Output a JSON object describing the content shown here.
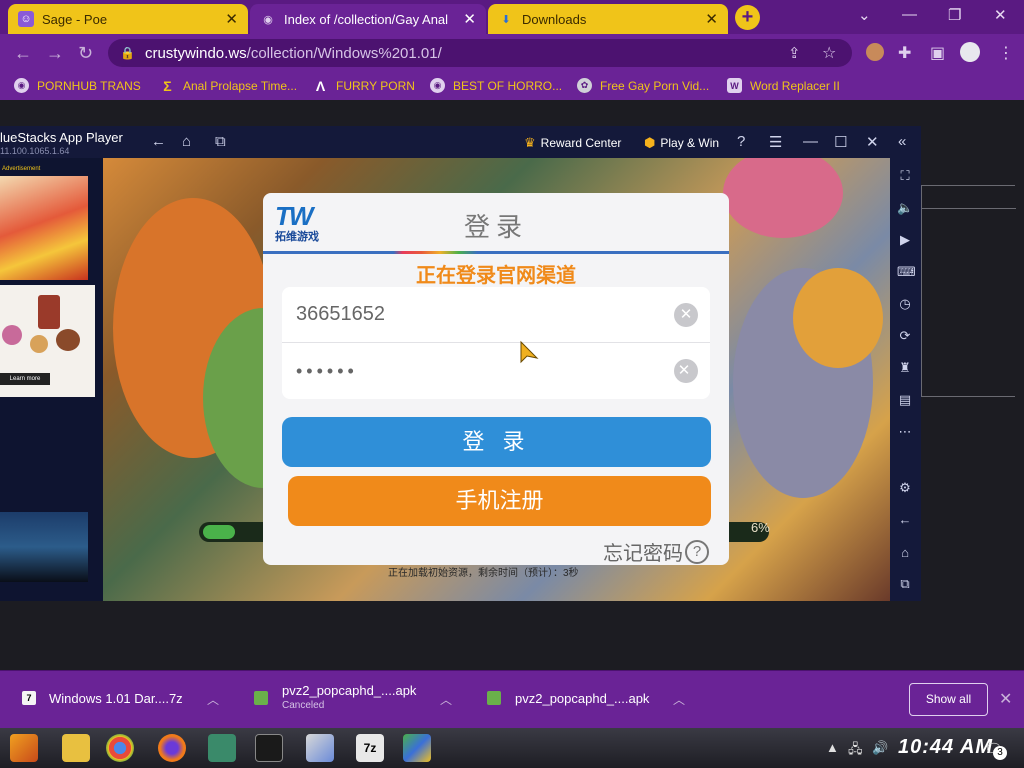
{
  "browser": {
    "tabs": [
      {
        "label": "Sage - Poe",
        "state": "inactive",
        "icon": "poe-icon"
      },
      {
        "label": "Index of /collection/Gay Anal",
        "state": "active",
        "icon": "globe-icon"
      },
      {
        "label": "Downloads",
        "state": "inactive",
        "icon": "download-icon"
      }
    ],
    "new_tab": "+",
    "window_controls": {
      "dropdown": "⌄",
      "minimize": "—",
      "restore": "❐",
      "close": "✕"
    },
    "url_host": "crustywindo.ws",
    "url_path": "/collection/Windows%201.01/",
    "bookmarks": [
      {
        "label": "PORNHUB TRANS"
      },
      {
        "label": "Anal Prolapse Time..."
      },
      {
        "label": "FURRY PORN"
      },
      {
        "label": "BEST OF HORRO..."
      },
      {
        "label": "Free Gay Porn Vid..."
      },
      {
        "label": "Word Replacer II"
      }
    ]
  },
  "bluestacks": {
    "app_name": "lueStacks App Player",
    "version": "11.100.1065.1.64",
    "reward_center": "Reward Center",
    "play_win": "Play & Win",
    "ad_label": "Advertisement",
    "ad_learn": "Learn more"
  },
  "game": {
    "progress_pct": 6,
    "progress_label": "6%",
    "loading_text": "正在加载初始资源，剩余时间（预计）：3秒"
  },
  "login": {
    "logo_text": "TW",
    "logo_sub": "拓维游戏",
    "title": "登录",
    "subtitle": "正在登录官网渠道",
    "username": "36651652",
    "password_mask": "••••••",
    "clear_glyph": "✕",
    "login_button": "登 录",
    "register_button": "手机注册",
    "forgot": "忘记密码",
    "forgot_q": "?"
  },
  "downloads": {
    "items": [
      {
        "name": "Windows 1.01 Dar....7z",
        "status": ""
      },
      {
        "name": "pvz2_popcaphd_....apk",
        "status": "Canceled"
      },
      {
        "name": "pvz2_popcaphd_....apk",
        "status": ""
      }
    ],
    "show_all": "Show all",
    "close": "✕"
  },
  "taskbar": {
    "clock": "10:44 AM",
    "notification_count": "3"
  },
  "colors": {
    "tab_yellow": "#f0c419",
    "chrome_purple": "#6a2396",
    "login_blue": "#2f8fd8",
    "register_orange": "#f08a1a"
  }
}
